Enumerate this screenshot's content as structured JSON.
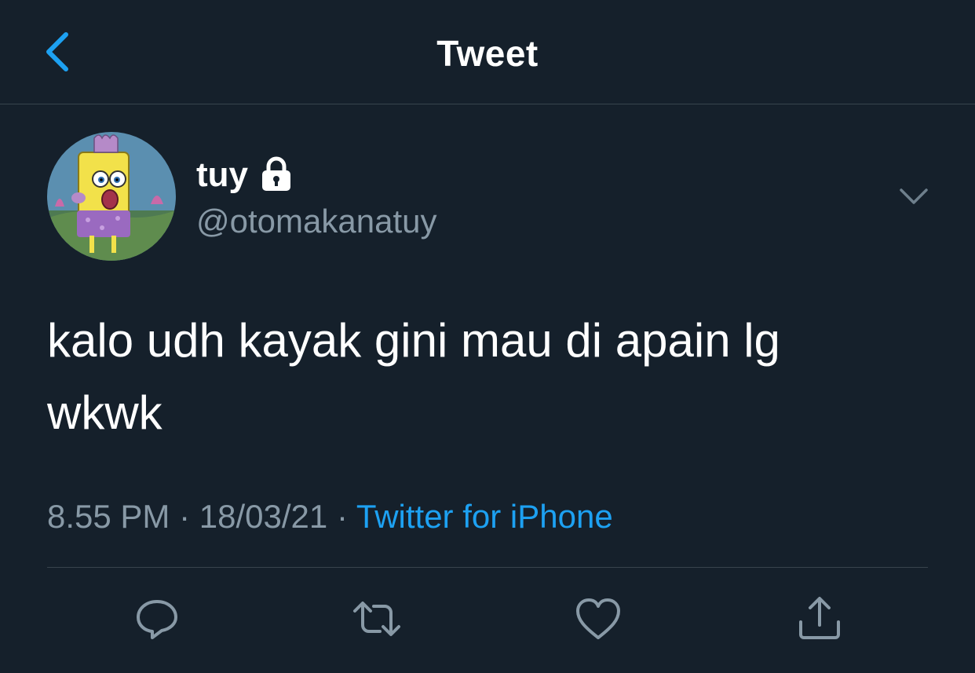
{
  "header": {
    "title": "Tweet",
    "back_icon": "chevron-left-icon"
  },
  "tweet": {
    "author": {
      "display_name": "tuy",
      "handle": "@otomakanatuy",
      "protected_icon": "lock-icon"
    },
    "text_line1": "kalo udh kayak gini mau di apain lg",
    "text_line2": "wkwk",
    "time": "8.55 PM",
    "separator": "·",
    "date": "18/03/21",
    "source": "Twitter for iPhone"
  },
  "actions": [
    "reply-icon",
    "retweet-icon",
    "like-icon",
    "share-icon"
  ],
  "colors": {
    "background": "#15202b",
    "accent": "#1da1f2",
    "secondary_text": "#8899a6",
    "divider": "#38444d"
  }
}
